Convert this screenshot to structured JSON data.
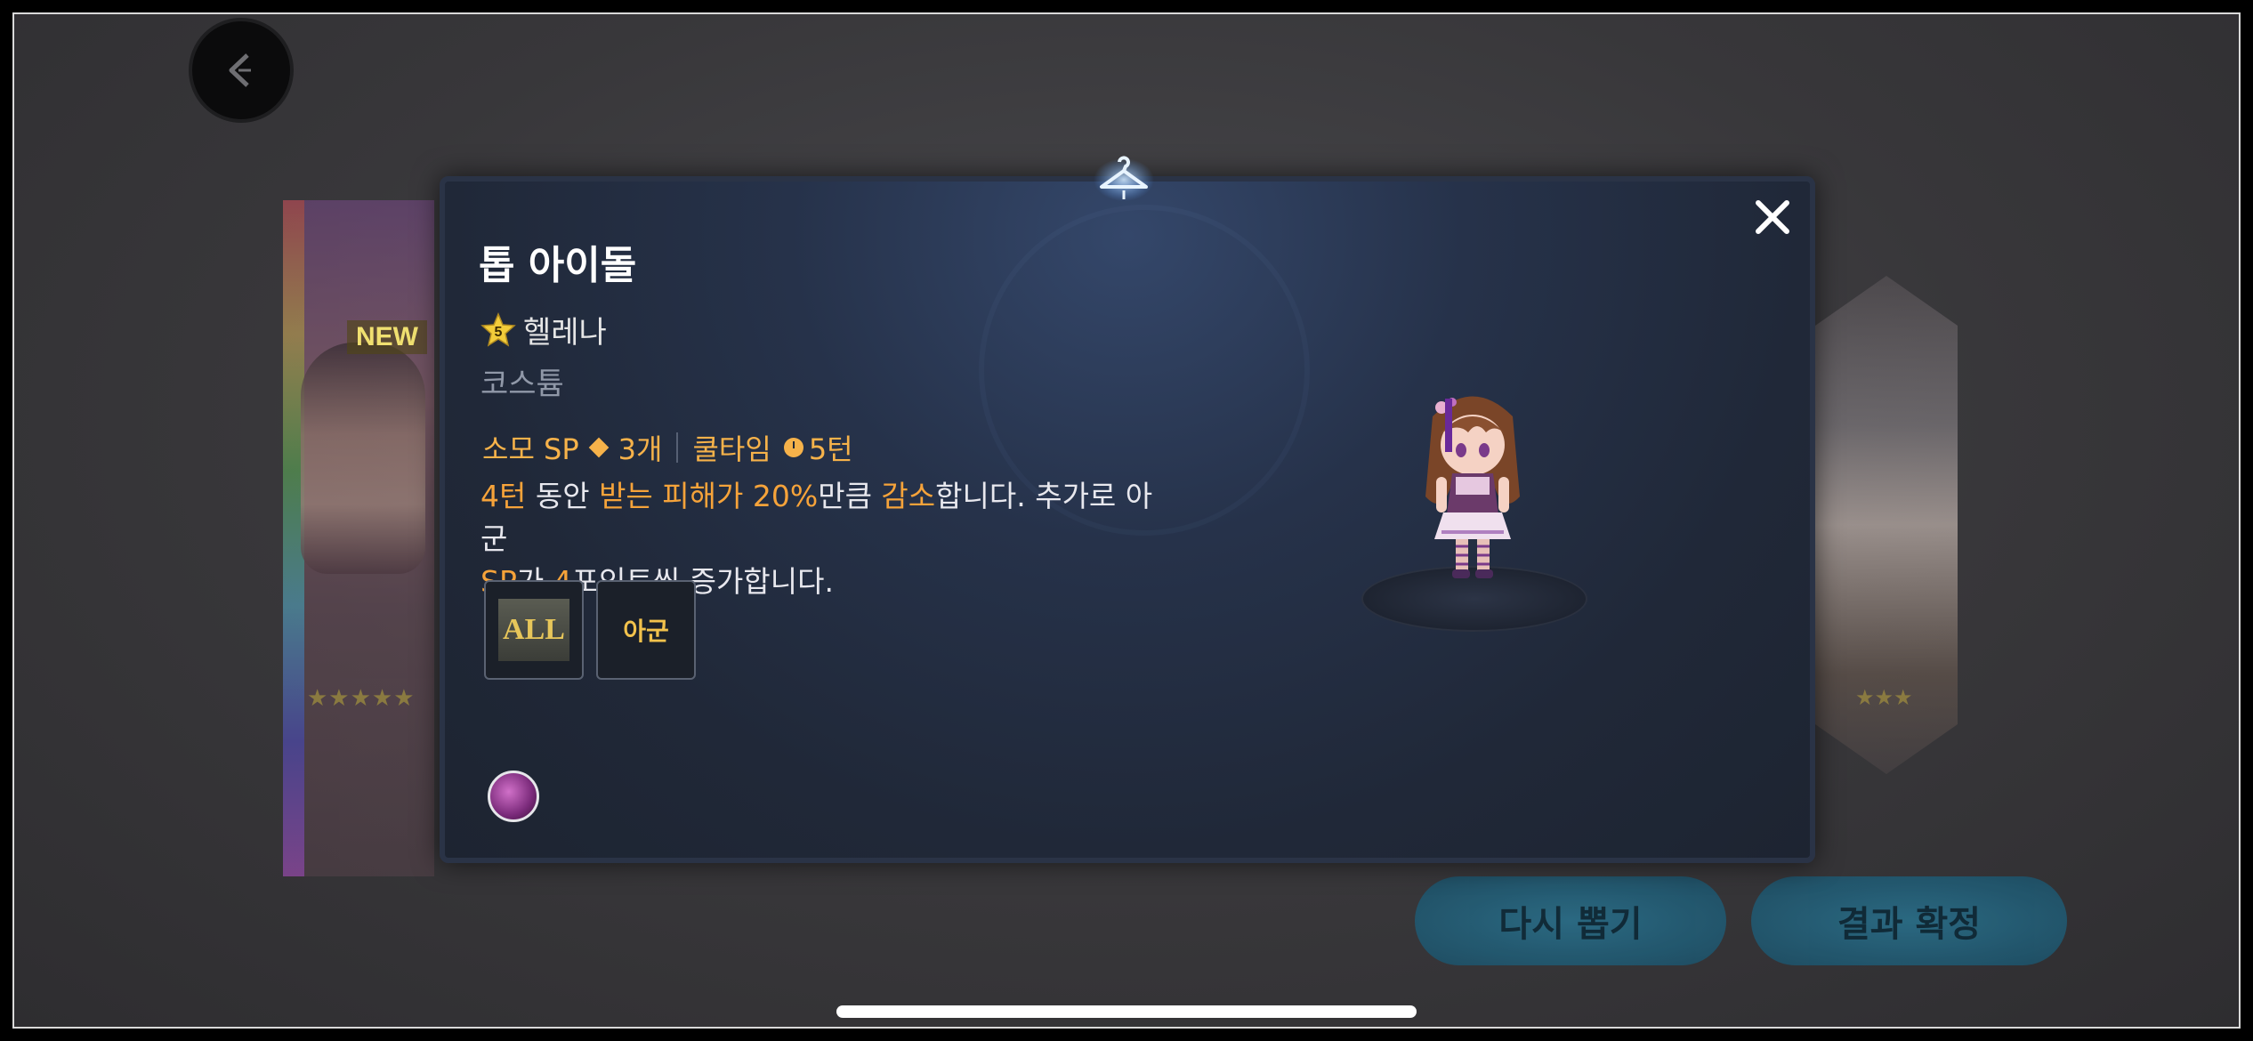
{
  "background": {
    "new_badge": "NEW",
    "left_card_stars": "★★★★★",
    "right_card_stars": "★★★",
    "buttons": {
      "redraw_label": "다시 뽑기",
      "confirm_label": "결과 확정"
    }
  },
  "modal": {
    "title": "톱 아이돌",
    "character": {
      "star_level": "5",
      "name": "헬레나"
    },
    "type_label": "코스튬",
    "stats": {
      "sp_cost": "소모 SP",
      "sp_value": "3개",
      "cooldown_label": "쿨타임",
      "cooldown_value": "5턴"
    },
    "description": {
      "p1": "4턴",
      "p2": " 동안 ",
      "p3": "받는 피해가 20%",
      "p4": "만큼 ",
      "p5": "감소",
      "p6": "합니다. 추가로 아군",
      "p7": "SP",
      "p8": "가 ",
      "p9": "4",
      "p10": "포인트씩 증가합니다."
    },
    "tags": {
      "target_all": "ALL",
      "target_ally": "아군"
    }
  },
  "icons": {
    "back": "back-arrow-icon",
    "close": "close-icon",
    "hanger": "hanger-icon",
    "skill": "skill-portrait-icon"
  },
  "colors": {
    "accent": "#f6a33a",
    "modal_bg": "#202838",
    "button_bg": "#1c4f66"
  }
}
